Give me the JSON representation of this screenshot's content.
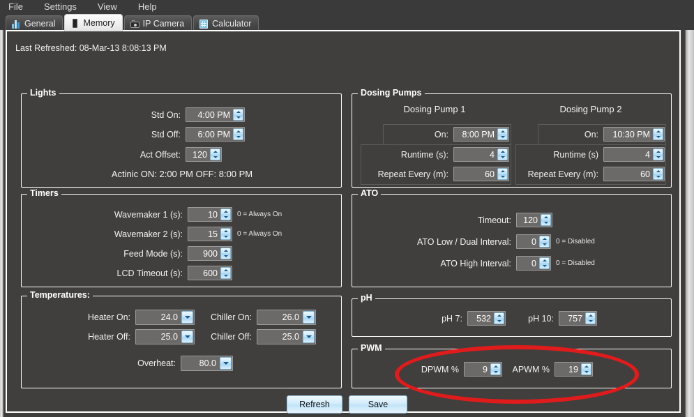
{
  "menu": {
    "items": [
      {
        "label": "File"
      },
      {
        "label": "Settings"
      },
      {
        "label": "View"
      },
      {
        "label": "Help"
      }
    ]
  },
  "tabs": [
    {
      "label": "General",
      "icon": "bar-chart-icon",
      "active": false
    },
    {
      "label": "Memory",
      "icon": "memory-chip-icon",
      "active": true
    },
    {
      "label": "IP Camera",
      "icon": "camera-icon",
      "active": false
    },
    {
      "label": "Calculator",
      "icon": "calculator-icon",
      "active": false
    }
  ],
  "status": {
    "last_refreshed": "Last Refreshed: 08-Mar-13 8:08:13 PM"
  },
  "lights": {
    "title": "Lights",
    "std_on_label": "Std On:",
    "std_on_value": "4:00 PM",
    "std_off_label": "Std Off:",
    "std_off_value": "6:00 PM",
    "act_offset_label": "Act Offset:",
    "act_offset_value": "120",
    "actinic_summary": "Actinic ON: 2:00 PM   OFF: 8:00 PM"
  },
  "dosing_pumps": {
    "title": "Dosing Pumps",
    "pump1_header": "Dosing Pump 1",
    "pump2_header": "Dosing Pump 2",
    "pump1": {
      "on_label": "On:",
      "on_value": "8:00 PM",
      "runtime_label": "Runtime (s):",
      "runtime_value": "4",
      "repeat_label": "Repeat Every (m):",
      "repeat_value": "60"
    },
    "pump2": {
      "on_label": "On:",
      "on_value": "10:30 PM",
      "runtime_label": "Runtime (s)",
      "runtime_value": "4",
      "repeat_label": "Repeat Every (m):",
      "repeat_value": "60"
    }
  },
  "timers": {
    "title": "Timers",
    "wavemaker1_label": "Wavemaker 1 (s):",
    "wavemaker1_value": "10",
    "wavemaker1_hint": "0 = Always On",
    "wavemaker2_label": "Wavemaker 2 (s):",
    "wavemaker2_value": "15",
    "wavemaker2_hint": "0 = Always On",
    "feed_mode_label": "Feed Mode (s):",
    "feed_mode_value": "900",
    "lcd_timeout_label": "LCD Timeout (s):",
    "lcd_timeout_value": "600"
  },
  "ato": {
    "title": "ATO",
    "timeout_label": "Timeout:",
    "timeout_value": "120",
    "low_dual_label": "ATO Low / Dual Interval:",
    "low_dual_value": "0",
    "low_dual_hint": "0 = Disabled",
    "high_label": "ATO High Interval:",
    "high_value": "0",
    "high_hint": "0 = Disabled"
  },
  "temperatures": {
    "title": "Temperatures:",
    "heater_on_label": "Heater On:",
    "heater_on_value": "24.0",
    "heater_off_label": "Heater Off:",
    "heater_off_value": "25.0",
    "chiller_on_label": "Chiller On:",
    "chiller_on_value": "26.0",
    "chiller_off_label": "Chiller Off:",
    "chiller_off_value": "25.0",
    "overheat_label": "Overheat:",
    "overheat_value": "80.0"
  },
  "ph": {
    "title": "pH",
    "ph7_label": "pH 7:",
    "ph7_value": "532",
    "ph10_label": "pH 10:",
    "ph10_value": "757"
  },
  "pwm": {
    "title": "PWM",
    "dpwm_label": "DPWM %",
    "dpwm_value": "9",
    "apwm_label": "APWM %",
    "apwm_value": "19"
  },
  "actions": {
    "refresh_label": "Refresh",
    "save_label": "Save"
  },
  "colors": {
    "window_background": "#3e3d3c",
    "panel_background": "#403f3e",
    "group_border": "#ffffff",
    "field_background": "#6b6a69",
    "spinner_accent": "#bfe3f7",
    "annotation_red": "#e01b1b",
    "active_tab_background": "#eeeeee"
  }
}
